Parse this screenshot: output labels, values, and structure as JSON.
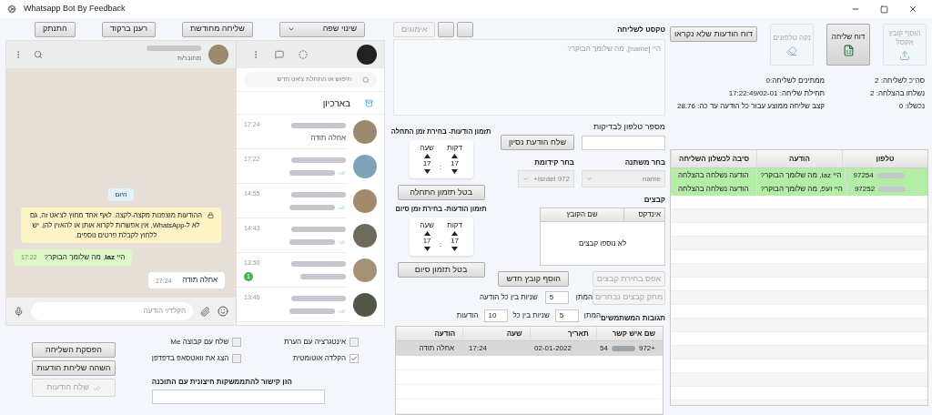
{
  "window": {
    "title": "Whatsapp Bot By Feedback"
  },
  "toolbar": {
    "language_dropdown": "שינוי שפה",
    "buttons": [
      "שליחה מחודשת",
      "רענן ברקוד",
      "התנתק"
    ]
  },
  "chat_list": {
    "search_placeholder": "חיפוש או התחלת צ'אט חדש",
    "archived": "בארכיון",
    "chats": [
      {
        "time": "17:24",
        "preview": "אחלה תודה",
        "ticks": false
      },
      {
        "time": "17:22",
        "ticks": true
      },
      {
        "time": "14:55",
        "ticks": true
      },
      {
        "time": "14:43",
        "ticks": true
      },
      {
        "time": "13:50",
        "ticks": false,
        "unread": "1"
      },
      {
        "time": "13:46",
        "ticks": true
      }
    ]
  },
  "conversation": {
    "status": "מחובר/ת",
    "date_chip": "היום",
    "encryption_notice": "ההודעות מוצפנות מקצה-לקצה. לאף אחד מחוץ לצ'אט זה, גם לא ל-WhatsApp, אין אפשרות לקרוא אותן או להאזין להן. יש ללחוץ לקבלת פרטים נוספים.",
    "messages": [
      {
        "kind": "outgoing",
        "text": "היי **Iaz**, מה שלומך הבוקר?",
        "time": "17:22"
      },
      {
        "kind": "incoming",
        "text": "אחלה תודה",
        "time": "17:24"
      }
    ],
    "input_placeholder": "הקלד/י הודעה"
  },
  "options": [
    {
      "label": "אינטגרציה עם הערת",
      "checked": false
    },
    {
      "label": "שלח עם קבוצה Me",
      "checked": false
    },
    {
      "label": "הקלדה אוטומטית",
      "checked": true
    },
    {
      "label": "הצג את וואטסאפ בדפדפן",
      "checked": false
    }
  ],
  "send_controls": [
    {
      "label": "הפסקת השליחה",
      "disabled": false,
      "kind": "plain"
    },
    {
      "label": "השהה שליחת הודעות",
      "disabled": false,
      "kind": "plain"
    },
    {
      "label": "שלח הודעות",
      "disabled": true,
      "kind": "send"
    }
  ],
  "webhook": {
    "label": "הזן קישור להתממשקות חיצונית עם התוכנה"
  },
  "message_editor": {
    "label": "טקסט לשליחה",
    "emoji_button": {
      "label": "אימוגים",
      "disabled": true
    },
    "placeholder": "היי [name], מה שלומך הבוקר?"
  },
  "test_phone": {
    "label": "מספר טלפון לבדיקות",
    "send_button": "שלח הודעת נסיון"
  },
  "variable": {
    "label": "בחר משתנה",
    "value": "name",
    "disabled": true
  },
  "prefix": {
    "label": "בחר קידומת",
    "value": "Israel 972+",
    "disabled": true
  },
  "files": {
    "label": "קבצים",
    "columns": [
      "אינדקס",
      "שם הקובץ"
    ],
    "empty": "לא נוספו קבצים",
    "buttons": [
      {
        "label": "הוסף קובץ חדש",
        "disabled": false
      },
      {
        "label": "אפס בחירת קבצים",
        "disabled": true
      },
      {
        "label": "מחק קבצים נבחרים",
        "disabled": true
      }
    ]
  },
  "schedules": [
    {
      "title": "תזמון הודעות- בחירת זמן התחלה",
      "fields": [
        {
          "label": "דקות",
          "value": "17"
        },
        {
          "label": "שעה",
          "value": "17"
        }
      ],
      "separator": ":",
      "cancel_button": "בטל תזמון התחלה"
    },
    {
      "title": "תזמון הודעות- בחירת זמן סיום",
      "fields": [
        {
          "label": "דקות",
          "value": "17"
        },
        {
          "label": "שעה",
          "value": "17"
        }
      ],
      "separator": ":",
      "cancel_button": "בטל תזמון סיום"
    }
  ],
  "delays": {
    "per_message": {
      "prefix": "המתן",
      "seconds": "5",
      "suffix": "שניות בין כל הודעה"
    },
    "per_batch": {
      "prefix": "המתן",
      "seconds": "5",
      "middle": "שניות בין כל",
      "count": "10",
      "suffix": "הודעות"
    }
  },
  "responses": {
    "title": "תגובות המשתמשים",
    "columns": [
      "שם איש קשר",
      "תאריך",
      "שעה",
      "הודעה"
    ],
    "rows": [
      {
        "contact_end": "54",
        "contact_start": "972+",
        "date": "02-01-2022",
        "time": "17:24",
        "message": "אחלה תודה",
        "selected": true
      }
    ]
  },
  "actions": [
    {
      "label": "הוסף קובץ אקסל",
      "kind": "upload",
      "disabled": true
    },
    {
      "label": "דוח שליחה",
      "kind": "excel",
      "disabled": false
    },
    {
      "label": "נקה טלפונים",
      "kind": "clear",
      "disabled": true
    }
  ],
  "unread_report_button": "דוח הודעות שלא נקראו",
  "stats": {
    "column_1": [
      "סה\"כ לשליחה: 2",
      "נשלחו בהצלחה: 2",
      "נכשלו: 0"
    ],
    "column_2": [
      "ממתינים לשליחה:0",
      "תחילת שליחה: 17:22:49/02-01",
      "קצב שליחה ממוצע עבור כל הודעה עד כה: 28.76"
    ]
  },
  "results": {
    "columns": [
      "טלפון",
      "הודעה",
      "סיבה לכשלון השליחה"
    ],
    "rows": [
      {
        "phone": "97254",
        "message": "היי Iaz, מה שלומך הבוקר?",
        "reason": "הודעה נשלחה בהצלחה",
        "success": true
      },
      {
        "phone": "97252",
        "message": "היי זעפ, מה שלומך הבוקר?",
        "reason": "הודעה נשלחה בהצלחה",
        "success": true
      }
    ]
  }
}
